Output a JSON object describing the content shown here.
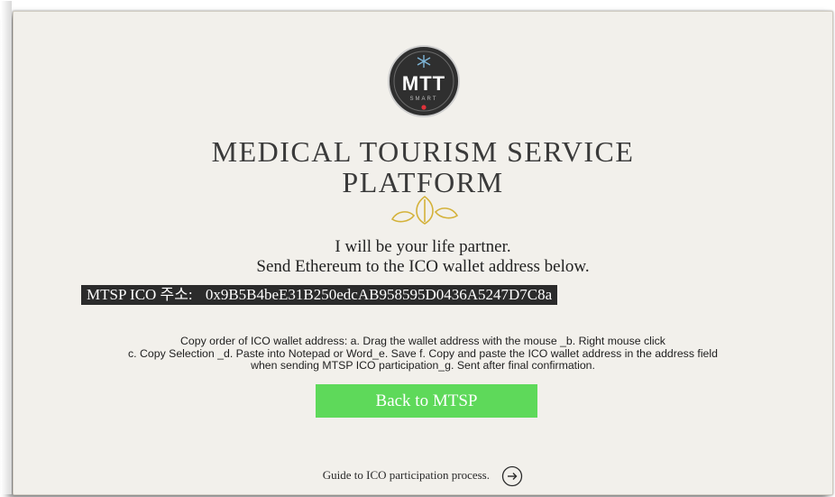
{
  "logo": {
    "brand_text": "MTT",
    "sub_text": "SMART",
    "icon": "mtt-smart-logo"
  },
  "header": {
    "title_line1": "MEDICAL TOURISM SERVICE",
    "title_line2": "PLATFORM"
  },
  "ornament": {
    "icon": "leaf-ornament-icon"
  },
  "tagline": {
    "line1": "I will be your life partner.",
    "line2": "Send Ethereum to the ICO wallet address below."
  },
  "wallet": {
    "label": "MTSP ICO 주소:",
    "address": "0x9B5B4beE31B250edcAB958595D0436A5247D7C8a"
  },
  "instructions": {
    "line1": "Copy order of ICO wallet address: a. Drag the wallet address with the mouse _b. Right mouse click",
    "line2": "c. Copy Selection _d. Paste into Notepad or Word_e. Save f. Copy and paste the ICO wallet address in the address field",
    "line3": "when sending MTSP ICO participation_g. Sent after final confirmation."
  },
  "actions": {
    "back_label": "Back to MTSP",
    "back_color": "#5ed95a"
  },
  "footer": {
    "guide_text": "Guide to ICO participation process.",
    "arrow_icon": "circle-arrow-right-icon"
  },
  "colors": {
    "panel_bg": "#f2f0eb",
    "wallet_bg": "#2b2b2b",
    "title_text": "#3a3a3a",
    "ornament_gold": "#d4b23a",
    "logo_dark": "#2f2f2f",
    "logo_accent": "#e0323a"
  }
}
